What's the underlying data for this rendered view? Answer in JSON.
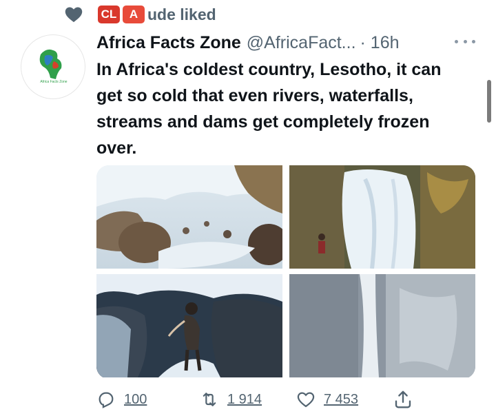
{
  "social_context": {
    "badge_1": "CL",
    "badge_2": "A",
    "text": "ude liked"
  },
  "tweet": {
    "author": "Africa Facts Zone",
    "handle": "@AfricaFact...",
    "time": "· 16h",
    "text": "In Africa's coldest country, Lesotho, it can get so cold that even rivers, waterfalls, streams and dams get completely frozen over.",
    "avatar_text": "Africa Facts Zone"
  },
  "actions": {
    "replies": "100",
    "retweets": "1 914",
    "likes": "7 453"
  },
  "colors": {
    "accent": "#1d9bf0",
    "muted": "#536471",
    "badge_red": "#d9382c"
  },
  "icons": [
    "heart-icon",
    "more-icon",
    "reply-icon",
    "retweet-icon",
    "like-icon",
    "share-icon"
  ]
}
